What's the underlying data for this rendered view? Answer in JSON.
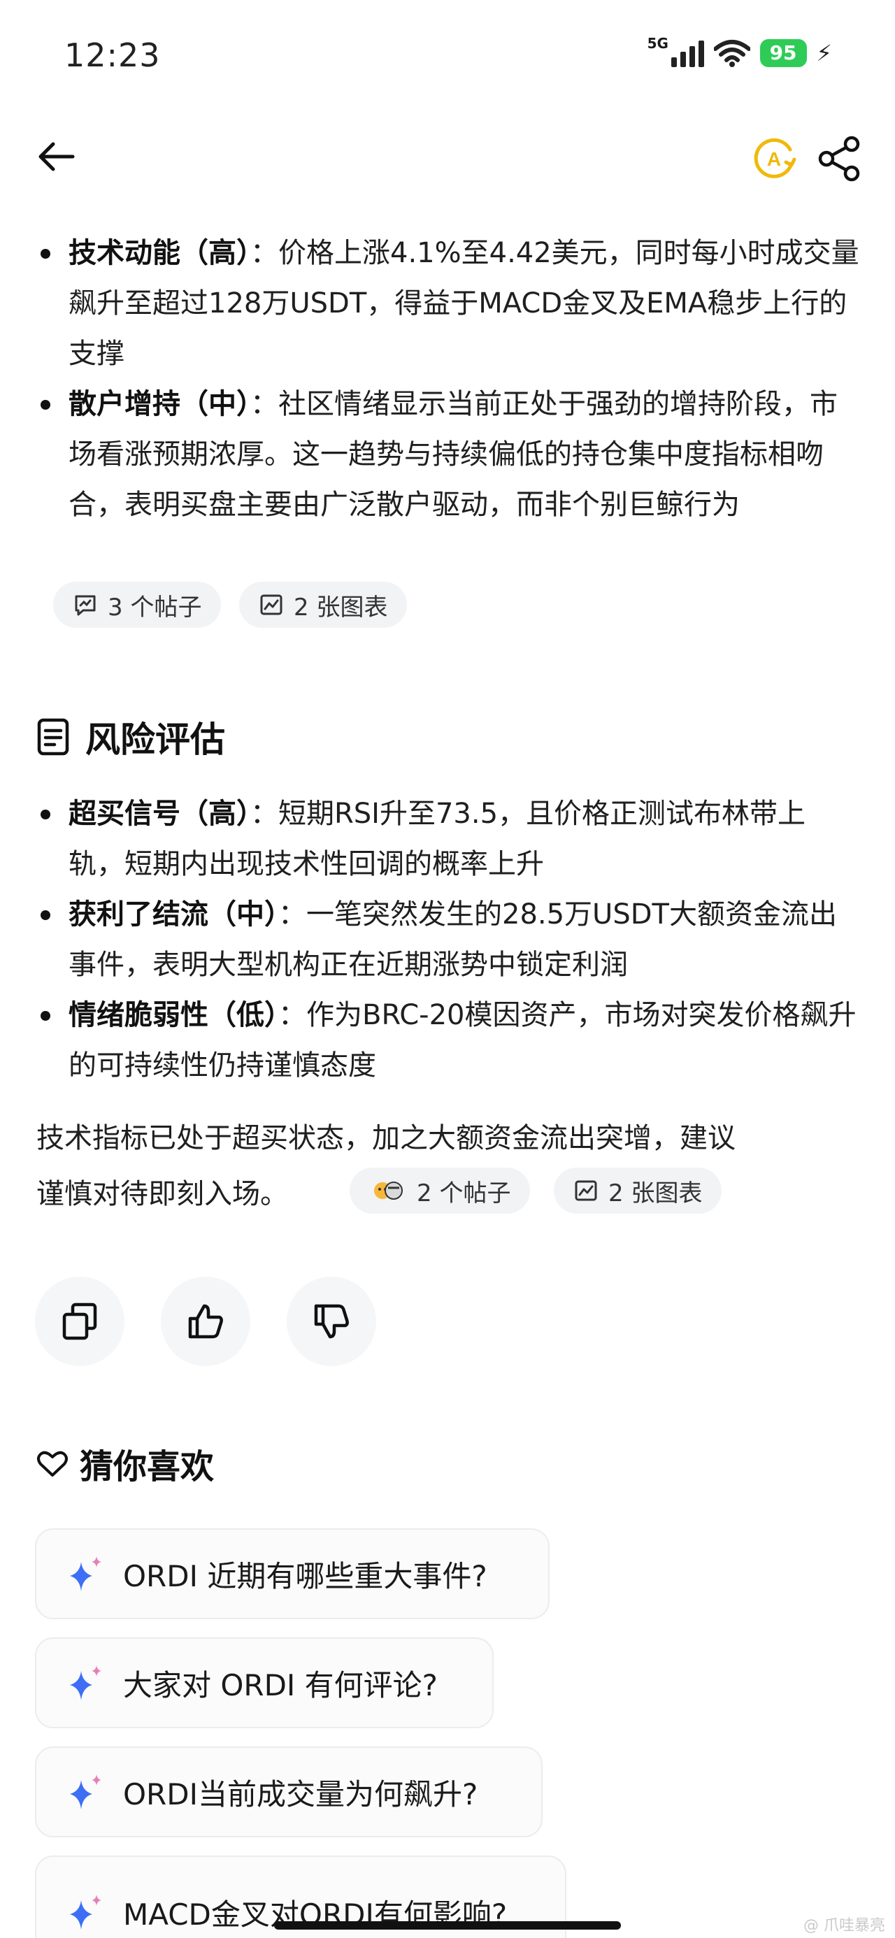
{
  "status": {
    "time": "12:23",
    "network": "5G",
    "battery": "95"
  },
  "bullets_top": [
    {
      "head": "技术动能（高）",
      "sep": "：",
      "body": "价格上涨4.1%至4.42美元，同时每小时成交量飙升至超过128万USDT，得益于MACD金叉及EMA稳步上行的支撑"
    },
    {
      "head": "散户增持（中）",
      "sep": "：",
      "body": "社区情绪显示当前正处于强劲的增持阶段，市场看涨预期浓厚。这一趋势与持续偏低的持仓集中度指标相吻合，表明买盘主要由广泛散户驱动，而非个别巨鲸行为"
    }
  ],
  "chips_top": {
    "posts": "3 个帖子",
    "charts": "2 张图表"
  },
  "risk_section": {
    "title": "风险评估"
  },
  "bullets_risk": [
    {
      "head": "超买信号（高）",
      "sep": "：",
      "body": "短期RSI升至73.5，且价格正测试布林带上轨，短期内出现技术性回调的概率上升"
    },
    {
      "head": "获利了结流（中）",
      "sep": "：",
      "body": "一笔突然发生的28.5万USDT大额资金流出事件，表明大型机构正在近期涨势中锁定利润"
    },
    {
      "head": "情绪脆弱性（低）",
      "sep": "：",
      "body": "作为BRC-20模因资产，市场对突发价格飙升的可持续性仍持谨慎态度"
    }
  ],
  "summary": {
    "line1": "技术指标已处于超买状态，加之大额资金流出突增，建议",
    "line2": "谨慎对待即刻入场。"
  },
  "chips_bottom": {
    "posts": "2 个帖子",
    "charts": "2 张图表"
  },
  "guess_section": {
    "title": "猜你喜欢"
  },
  "suggestions": [
    "ORDI 近期有哪些重大事件?",
    "大家对 ORDI 有何评论?",
    "ORDI当前成交量为何飙升?",
    "MACD金叉对ORDI有何影响?"
  ],
  "watermark": "@ 爪哇暴亮",
  "colors": {
    "battery": "#2ecc57",
    "translate_icon": "#f0b90b",
    "sparkle_blue": "#3d6ef5",
    "sparkle_pink": "#e87fb6"
  }
}
